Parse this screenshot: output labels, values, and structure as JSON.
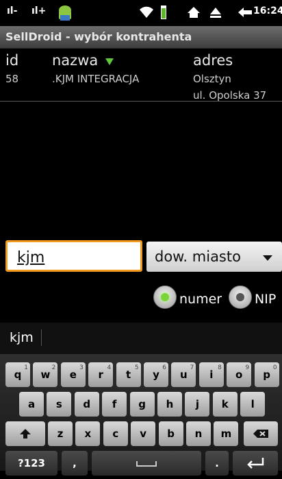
{
  "status_bar": {
    "time": "16:24"
  },
  "title_bar": {
    "title": "SellDroid - wybór kontrahenta"
  },
  "table": {
    "columns": [
      "id",
      "nazwa",
      "adres"
    ],
    "rows": [
      {
        "id": "58",
        "nazwa": ".KJM INTEGRACJA",
        "adres_line1": "Olsztyn",
        "adres_line2": "ul. Opolska 37"
      }
    ]
  },
  "search": {
    "value": "kjm"
  },
  "dropdown": {
    "selected": "dow. miasto"
  },
  "radio": {
    "numer_label": "numer",
    "nip_label": "NIP",
    "selected": "numer"
  },
  "suggestions": {
    "word": "kjm"
  },
  "keyboard": {
    "row1": [
      "q",
      "w",
      "e",
      "r",
      "t",
      "y",
      "u",
      "i",
      "o",
      "p"
    ],
    "row1_alt": [
      "1",
      "2",
      "3",
      "4",
      "5",
      "6",
      "7",
      "8",
      "9",
      "0"
    ],
    "row2": [
      "a",
      "s",
      "d",
      "f",
      "g",
      "h",
      "j",
      "k",
      "l"
    ],
    "row3": [
      "z",
      "x",
      "c",
      "v",
      "b",
      "n",
      "m"
    ],
    "symbols_label": "?123",
    "comma_label": ",",
    "period_label": "."
  },
  "colors": {
    "accent": "#f49b1f",
    "radio_on": "#7ad43a"
  }
}
